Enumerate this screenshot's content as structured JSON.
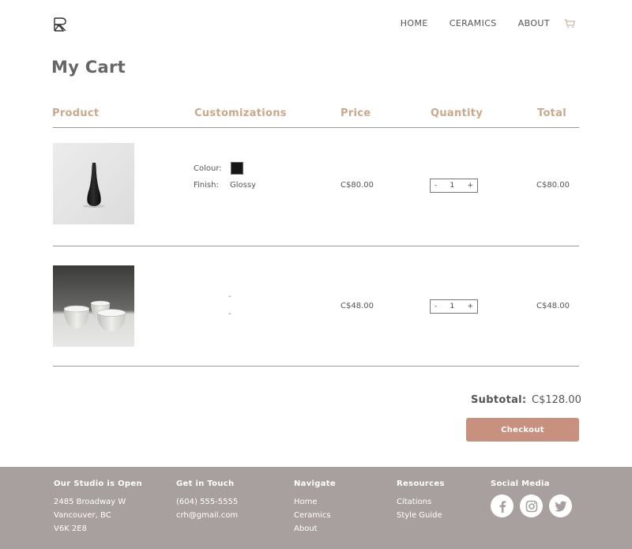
{
  "header": {
    "nav": [
      "HOME",
      "CERAMICS",
      "ABOUT"
    ]
  },
  "page_title": "My Cart",
  "table": {
    "columns": [
      "Product",
      "Customizations",
      "Price",
      "Quantity",
      "Total"
    ],
    "rows": [
      {
        "product_image": "black-vase",
        "customizations": [
          {
            "label": "Colour:",
            "value": "",
            "swatch": "#161616"
          },
          {
            "label": "Finish:",
            "value": "Glossy"
          }
        ],
        "price": "C$80.00",
        "qty_minus": "-",
        "qty": "1",
        "qty_plus": "+",
        "total": "C$80.00"
      },
      {
        "product_image": "white-cups",
        "customizations_empty": [
          "-",
          "-"
        ],
        "price": "C$48.00",
        "qty_minus": "-",
        "qty": "1",
        "qty_plus": "+",
        "total": "C$48.00"
      }
    ]
  },
  "summary": {
    "subtotal_label": "Subtotal:",
    "subtotal_value": "C$128.00",
    "checkout_label": "Checkout"
  },
  "footer": {
    "studio": {
      "heading": "Our Studio is Open",
      "lines": [
        "2485 Broadway W",
        "Vancouver, BC",
        "V6K 2E8"
      ]
    },
    "contact": {
      "heading": "Get in Touch",
      "lines": [
        "(604) 555-5555",
        "crh@gmail.com"
      ]
    },
    "navigate": {
      "heading": "Navigate",
      "links": [
        "Home",
        "Ceramics",
        "About"
      ]
    },
    "resources": {
      "heading": "Resources",
      "links": [
        "Citations",
        "Style Guide"
      ]
    },
    "social": {
      "heading": "Social Media",
      "icons": [
        "facebook-icon",
        "instagram-icon",
        "twitter-icon"
      ]
    }
  },
  "colors": {
    "accent_header": "#c9a88c",
    "checkout_button": "#c8907e",
    "footer_bg": "#a8a09e"
  }
}
